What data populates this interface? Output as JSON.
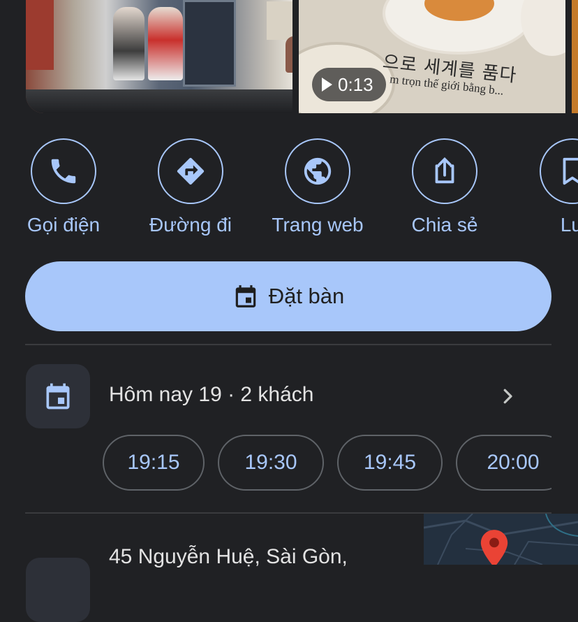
{
  "photos": {
    "video_duration": "0:13",
    "photo2_overlay_line1": "으로 세계를 품다",
    "photo2_overlay_line2": "m trọn thế giới bằng b..."
  },
  "actions": [
    {
      "label": "Gọi điện",
      "icon": "phone-icon"
    },
    {
      "label": "Đường đi",
      "icon": "directions-icon"
    },
    {
      "label": "Trang web",
      "icon": "globe-icon"
    },
    {
      "label": "Chia sẻ",
      "icon": "share-icon"
    },
    {
      "label": "Lư",
      "icon": "bookmark-icon"
    }
  ],
  "reserve_button": {
    "label": "Đặt bàn",
    "icon": "calendar-icon"
  },
  "reservation": {
    "date_summary": "Hôm nay 19 · 2 khách",
    "time_slots": [
      "19:15",
      "19:30",
      "19:45",
      "20:00"
    ]
  },
  "address": {
    "text": "45 Nguyễn Huệ, Sài Gòn,"
  },
  "colors": {
    "background": "#202124",
    "accent": "#a8c7fa",
    "text": "#e3e3e3",
    "pin": "#ea4335"
  }
}
